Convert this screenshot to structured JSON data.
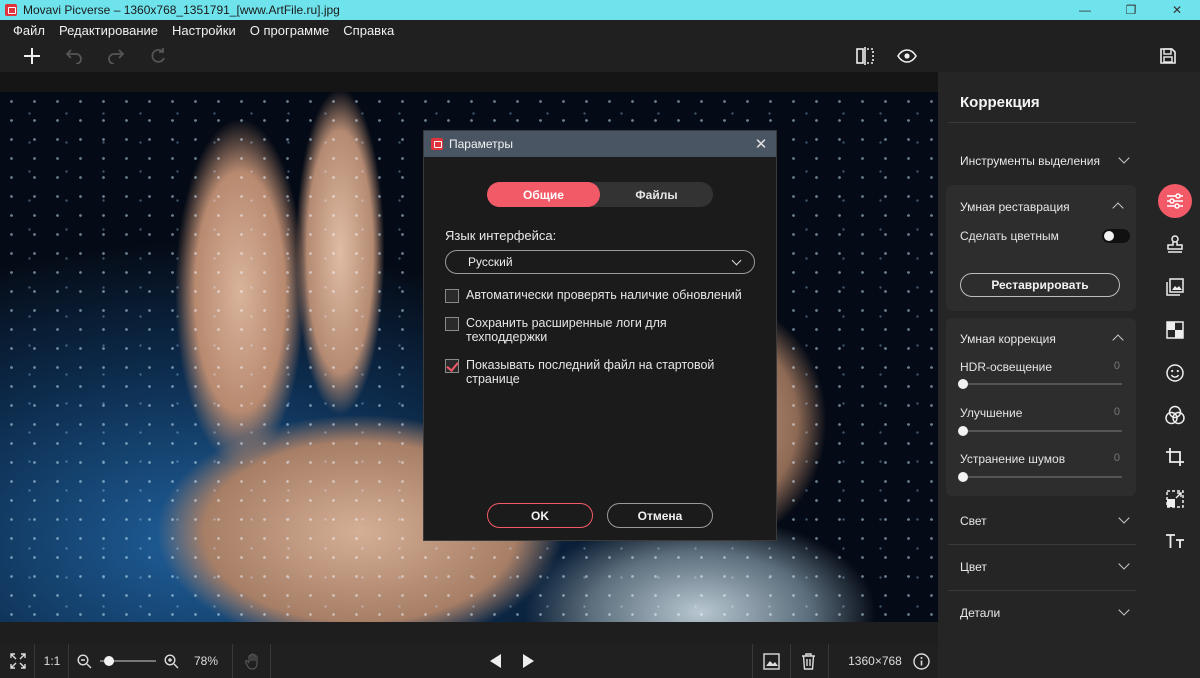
{
  "window": {
    "title": "Movavi Picverse – 1360x768_1351791_[www.ArtFile.ru].jpg",
    "minimize": "—",
    "maximize": "❐",
    "close": "✕"
  },
  "menu": [
    "Файл",
    "Редактирование",
    "Настройки",
    "О программе",
    "Справка"
  ],
  "toolbar": {
    "icons": [
      "add-icon",
      "undo-icon",
      "redo-icon",
      "reset-icon",
      "compare-icon",
      "preview-eye-icon",
      "save-icon"
    ]
  },
  "bottombar": {
    "ratio_label": "1:1",
    "zoom_value": 0.78,
    "zoom_label": "78%",
    "image_size": "1360×768"
  },
  "panel": {
    "title": "Коррекция",
    "selection_tools": "Инструменты выделения",
    "smart_restore": {
      "title": "Умная реставрация",
      "colorize_label": "Сделать цветным",
      "colorize_on": false,
      "button": "Реставрировать"
    },
    "smart_correction": {
      "title": "Умная коррекция",
      "sliders": [
        {
          "label": "HDR-освещение",
          "value": "0"
        },
        {
          "label": "Улучшение",
          "value": "0"
        },
        {
          "label": "Устранение шумов",
          "value": "0"
        }
      ]
    },
    "sections": [
      "Свет",
      "Цвет",
      "Детали"
    ]
  },
  "rail": {
    "icons": [
      "adjust-sliders-icon",
      "stamp-icon",
      "image-replace-icon",
      "checker-icon",
      "face-icon",
      "color-circles-icon",
      "crop-icon",
      "resize-icon",
      "text-icon"
    ],
    "accent": "#f35a68"
  },
  "dialog": {
    "title": "Параметры",
    "tabs": [
      "Общие",
      "Файлы"
    ],
    "active_tab": "Общие",
    "language_label": "Язык интерфейса:",
    "language_value": "Русский",
    "options": [
      {
        "label": "Автоматически проверять наличие обновлений",
        "checked": false
      },
      {
        "label": "Сохранить расширенные логи для техподдержки",
        "checked": false
      },
      {
        "label": "Показывать последний файл на стартовой странице",
        "checked": true
      }
    ],
    "ok": "OK",
    "cancel": "Отмена"
  }
}
